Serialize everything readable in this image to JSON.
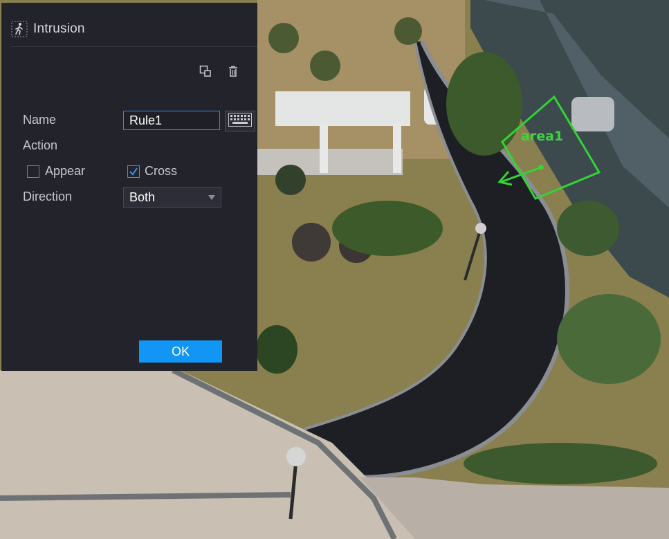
{
  "dialog": {
    "title": "Intrusion",
    "title_icon": "person-walking-icon",
    "tools": [
      "copy-icon",
      "trash-icon"
    ],
    "name_label": "Name",
    "name_value": "Rule1",
    "keyboard_icon": "keyboard-icon",
    "action_label": "Action",
    "appear_label": "Appear",
    "appear_checked": false,
    "cross_label": "Cross",
    "cross_checked": true,
    "direction_label": "Direction",
    "direction_value": "Both",
    "ok_label": "OK"
  },
  "video": {
    "area_label": "area1",
    "area_color": "#33d433"
  },
  "colors": {
    "panel_bg": "#23232b",
    "accent": "#1296f5",
    "input_border": "#2f8de6"
  }
}
